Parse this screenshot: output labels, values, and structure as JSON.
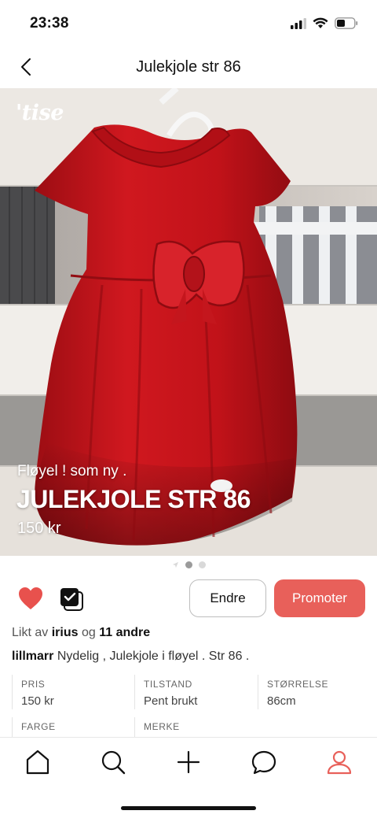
{
  "status_bar": {
    "time": "23:38"
  },
  "nav": {
    "title": "Julekjole str 86"
  },
  "photo": {
    "logo": "'tise",
    "subtitle": "Fløyel ! som ny .",
    "title": "JULEKJOLE STR 86",
    "price": "150 kr",
    "pager": {
      "count": 2,
      "active_index": 0
    }
  },
  "actions": {
    "edit_label": "Endre",
    "promote_label": "Promoter"
  },
  "likes": {
    "prefix": "Likt av",
    "user": "irius",
    "joiner": "og",
    "others": "11 andre"
  },
  "description": {
    "user": "lillmarr",
    "text": "Nydelig , Julekjole i fløyel . Str 86 ."
  },
  "attributes": [
    {
      "label": "PRIS",
      "value": "150 kr"
    },
    {
      "label": "TILSTAND",
      "value": "Pent brukt"
    },
    {
      "label": "STØRRELSE",
      "value": "86cm"
    },
    {
      "label": "FARGE",
      "value": ""
    },
    {
      "label": "MERKE",
      "value": ""
    }
  ],
  "colors": {
    "accent": "#e8605a",
    "heart": "#e8514d",
    "dress": "#c8141c"
  },
  "tab_bar": {
    "items": [
      "home-icon",
      "search-icon",
      "plus-icon",
      "chat-icon",
      "profile-icon"
    ],
    "active": "profile-icon"
  }
}
